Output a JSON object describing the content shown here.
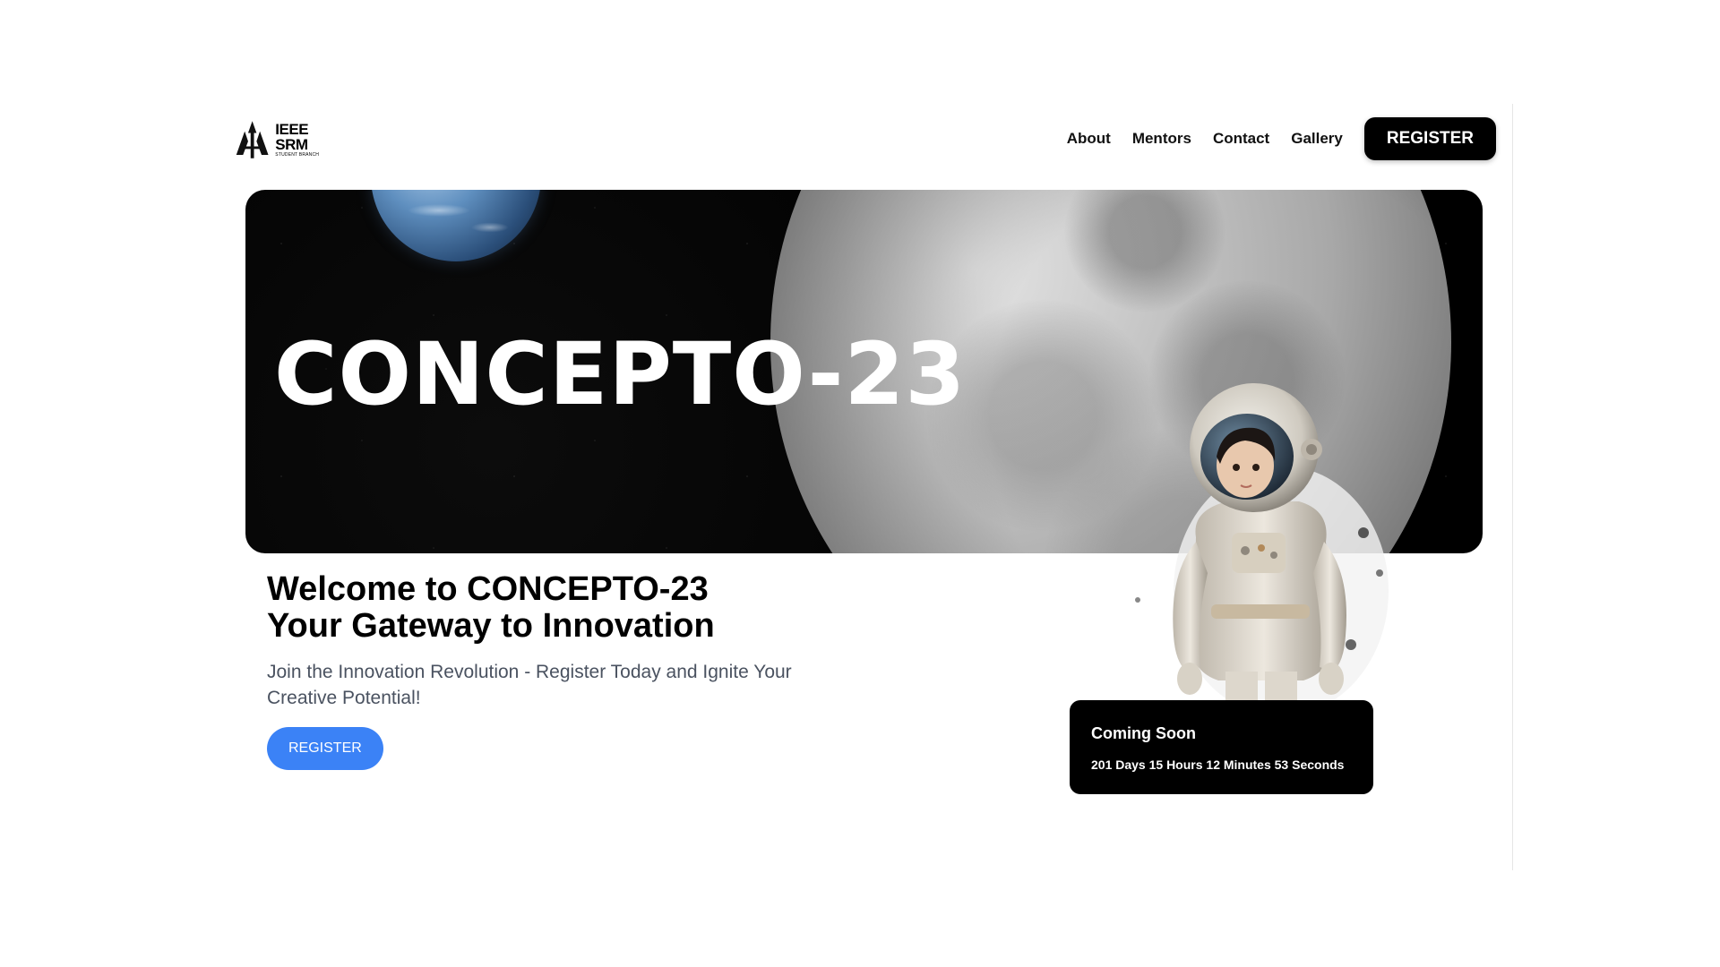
{
  "logo": {
    "name": "IEEE SRM",
    "subtitle": "STUDENT BRANCH"
  },
  "nav": {
    "links": [
      "About",
      "Mentors",
      "Contact",
      "Gallery"
    ],
    "register_label": "REGISTER"
  },
  "hero": {
    "title": "CONCEPTO-23"
  },
  "welcome": {
    "line1_prefix": "Welcome to ",
    "line1_event": "CONCEPTO-23",
    "line2": "Your Gateway to Innovation",
    "description": "Join the Innovation Revolution - Register Today and Ignite Your Creative Potential!",
    "register_label": "REGISTER"
  },
  "countdown": {
    "title": "Coming Soon",
    "time": "201 Days 15 Hours 12 Minutes 53 Seconds"
  },
  "colors": {
    "accent": "#3b82f6",
    "dark": "#000000",
    "text_muted": "#4a5260"
  }
}
